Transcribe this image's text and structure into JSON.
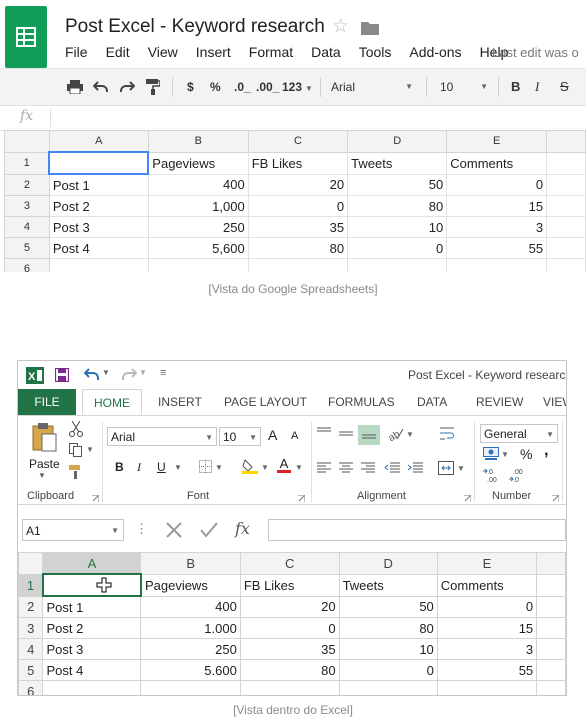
{
  "sheets": {
    "title": "Post Excel - Keyword research",
    "menu": [
      "File",
      "Edit",
      "View",
      "Insert",
      "Format",
      "Data",
      "Tools",
      "Add-ons",
      "Help"
    ],
    "last_edit": "Last edit was o",
    "toolbar": {
      "currency": "$",
      "percent": "%",
      "dec_decrease": ".0_",
      "dec_increase": ".00_",
      "more_formats": "123",
      "font": "Arial",
      "font_size": "10",
      "bold": "B",
      "italic": "I",
      "strike": "S"
    },
    "fx": "fx",
    "columns": [
      "A",
      "B",
      "C",
      "D",
      "E"
    ],
    "rows": [
      {
        "num": "1",
        "cells": [
          "",
          "Pageviews",
          "FB Likes",
          "Tweets",
          "Comments"
        ]
      },
      {
        "num": "2",
        "cells": [
          "Post 1",
          "400",
          "20",
          "50",
          "0"
        ]
      },
      {
        "num": "3",
        "cells": [
          "Post 2",
          "1,000",
          "0",
          "80",
          "15"
        ]
      },
      {
        "num": "4",
        "cells": [
          "Post 3",
          "250",
          "35",
          "10",
          "3"
        ]
      },
      {
        "num": "5",
        "cells": [
          "Post 4",
          "5,600",
          "80",
          "0",
          "55"
        ]
      },
      {
        "num": "6",
        "cells": [
          "",
          "",
          "",
          "",
          ""
        ]
      }
    ],
    "caption": "[Vista do Google Spreadsheets]"
  },
  "excel": {
    "title": "Post Excel - Keyword research",
    "tabs": [
      "FILE",
      "HOME",
      "INSERT",
      "PAGE LAYOUT",
      "FORMULAS",
      "DATA",
      "REVIEW",
      "VIEW"
    ],
    "ribbon": {
      "paste": "Paste",
      "clipboard": "Clipboard",
      "font_name": "Arial",
      "font_size": "10",
      "font_group": "Font",
      "alignment_group": "Alignment",
      "number_format": "General",
      "number_group": "Number",
      "bold": "B",
      "italic": "I",
      "underline": "U",
      "inc_font": "A",
      "dec_font": "A",
      "font_color": "A",
      "currency": "$",
      "percent": "%",
      "comma": ","
    },
    "name_box": "A1",
    "fx": "fx",
    "columns": [
      "A",
      "B",
      "C",
      "D",
      "E"
    ],
    "rows": [
      {
        "num": "1",
        "cells": [
          "",
          "Pageviews",
          "FB Likes",
          "Tweets",
          "Comments"
        ]
      },
      {
        "num": "2",
        "cells": [
          "Post 1",
          "400",
          "20",
          "50",
          "0"
        ]
      },
      {
        "num": "3",
        "cells": [
          "Post 2",
          "1.000",
          "0",
          "80",
          "15"
        ]
      },
      {
        "num": "4",
        "cells": [
          "Post 3",
          "250",
          "35",
          "10",
          "3"
        ]
      },
      {
        "num": "5",
        "cells": [
          "Post 4",
          "5.600",
          "80",
          "0",
          "55"
        ]
      },
      {
        "num": "6",
        "cells": [
          "",
          "",
          "",
          "",
          ""
        ]
      }
    ],
    "caption": "[Vista dentro do Excel]"
  },
  "colors": {
    "sheets_green": "#0f9d58",
    "sheets_select": "#4285f4",
    "excel_green": "#217346"
  }
}
